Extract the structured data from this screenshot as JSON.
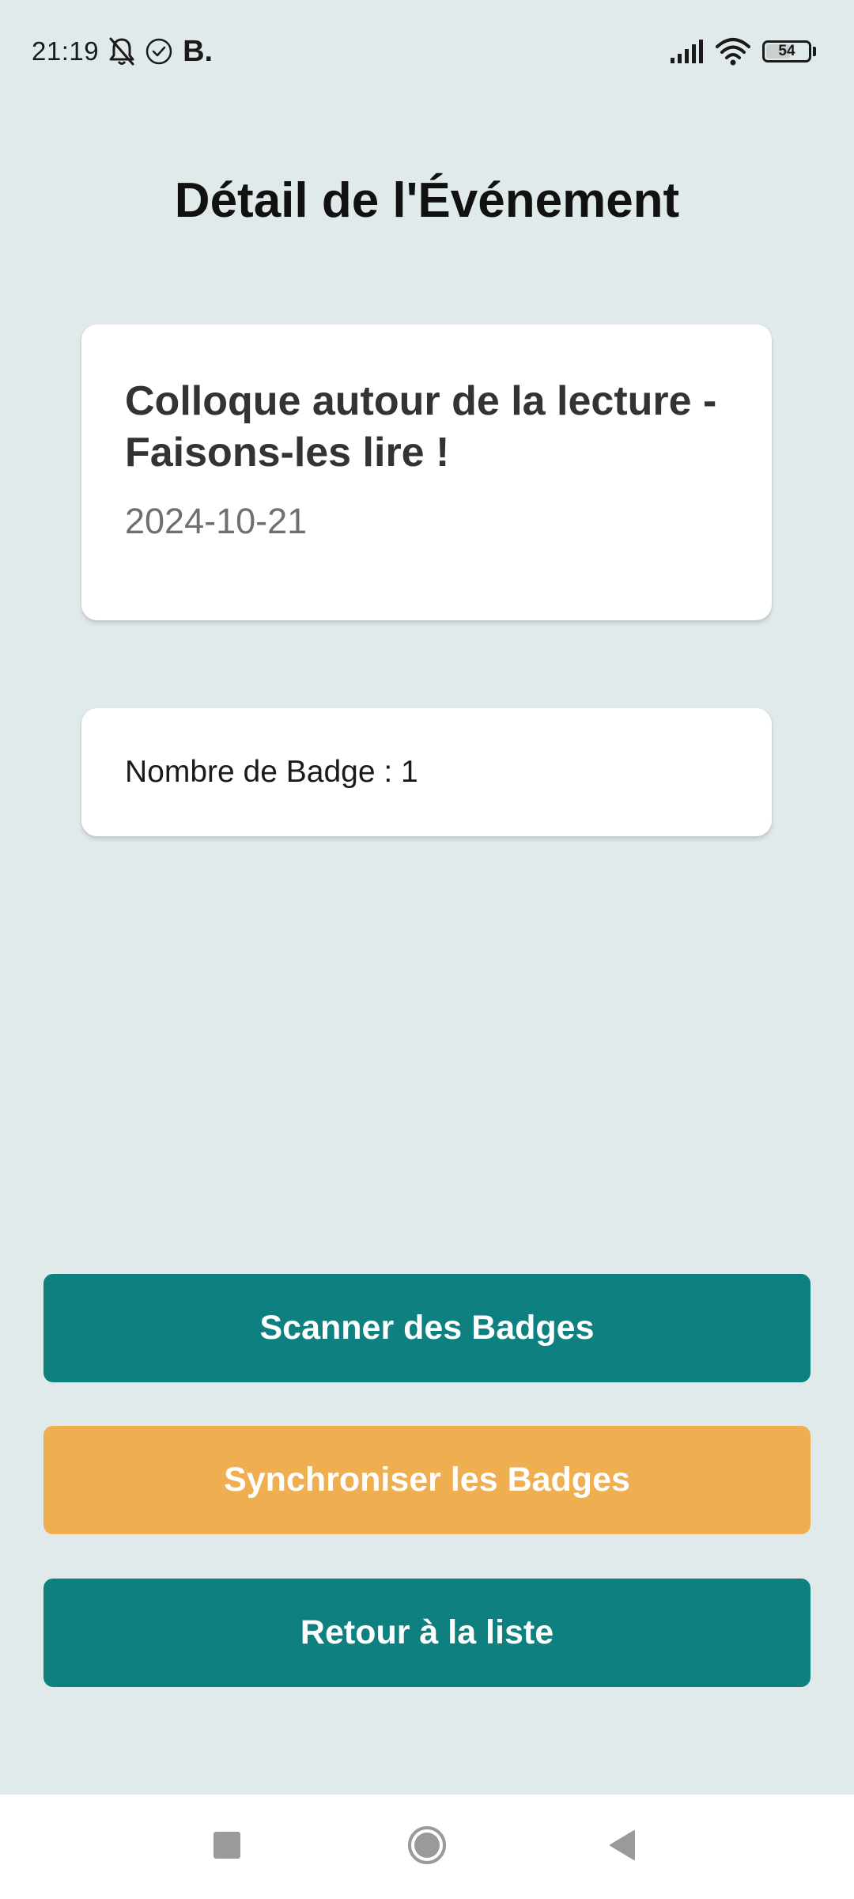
{
  "status_bar": {
    "time": "21:19",
    "app_badge": "B.",
    "battery_level": "54",
    "icons": [
      "bell-off-icon",
      "check-circle-icon",
      "signal-icon",
      "wifi-icon",
      "battery-icon"
    ]
  },
  "page": {
    "title": "Détail de l'Événement"
  },
  "event": {
    "name": "Colloque autour de la lecture - Faisons-les lire !",
    "date": "2024-10-21"
  },
  "badges": {
    "count_text": "Nombre de Badge : 1"
  },
  "actions": {
    "scan_label": "Scanner des Badges",
    "sync_label": "Synchroniser les Badges",
    "back_label": "Retour à la liste"
  },
  "nav_bar": {
    "icons": [
      "recents-icon",
      "home-icon",
      "back-icon"
    ]
  },
  "colors": {
    "background": "#e1eaea",
    "primary": "#0d807f",
    "accent": "#efae50",
    "card": "#ffffff",
    "title_text": "#111111",
    "date_text": "#6f6f6f"
  }
}
